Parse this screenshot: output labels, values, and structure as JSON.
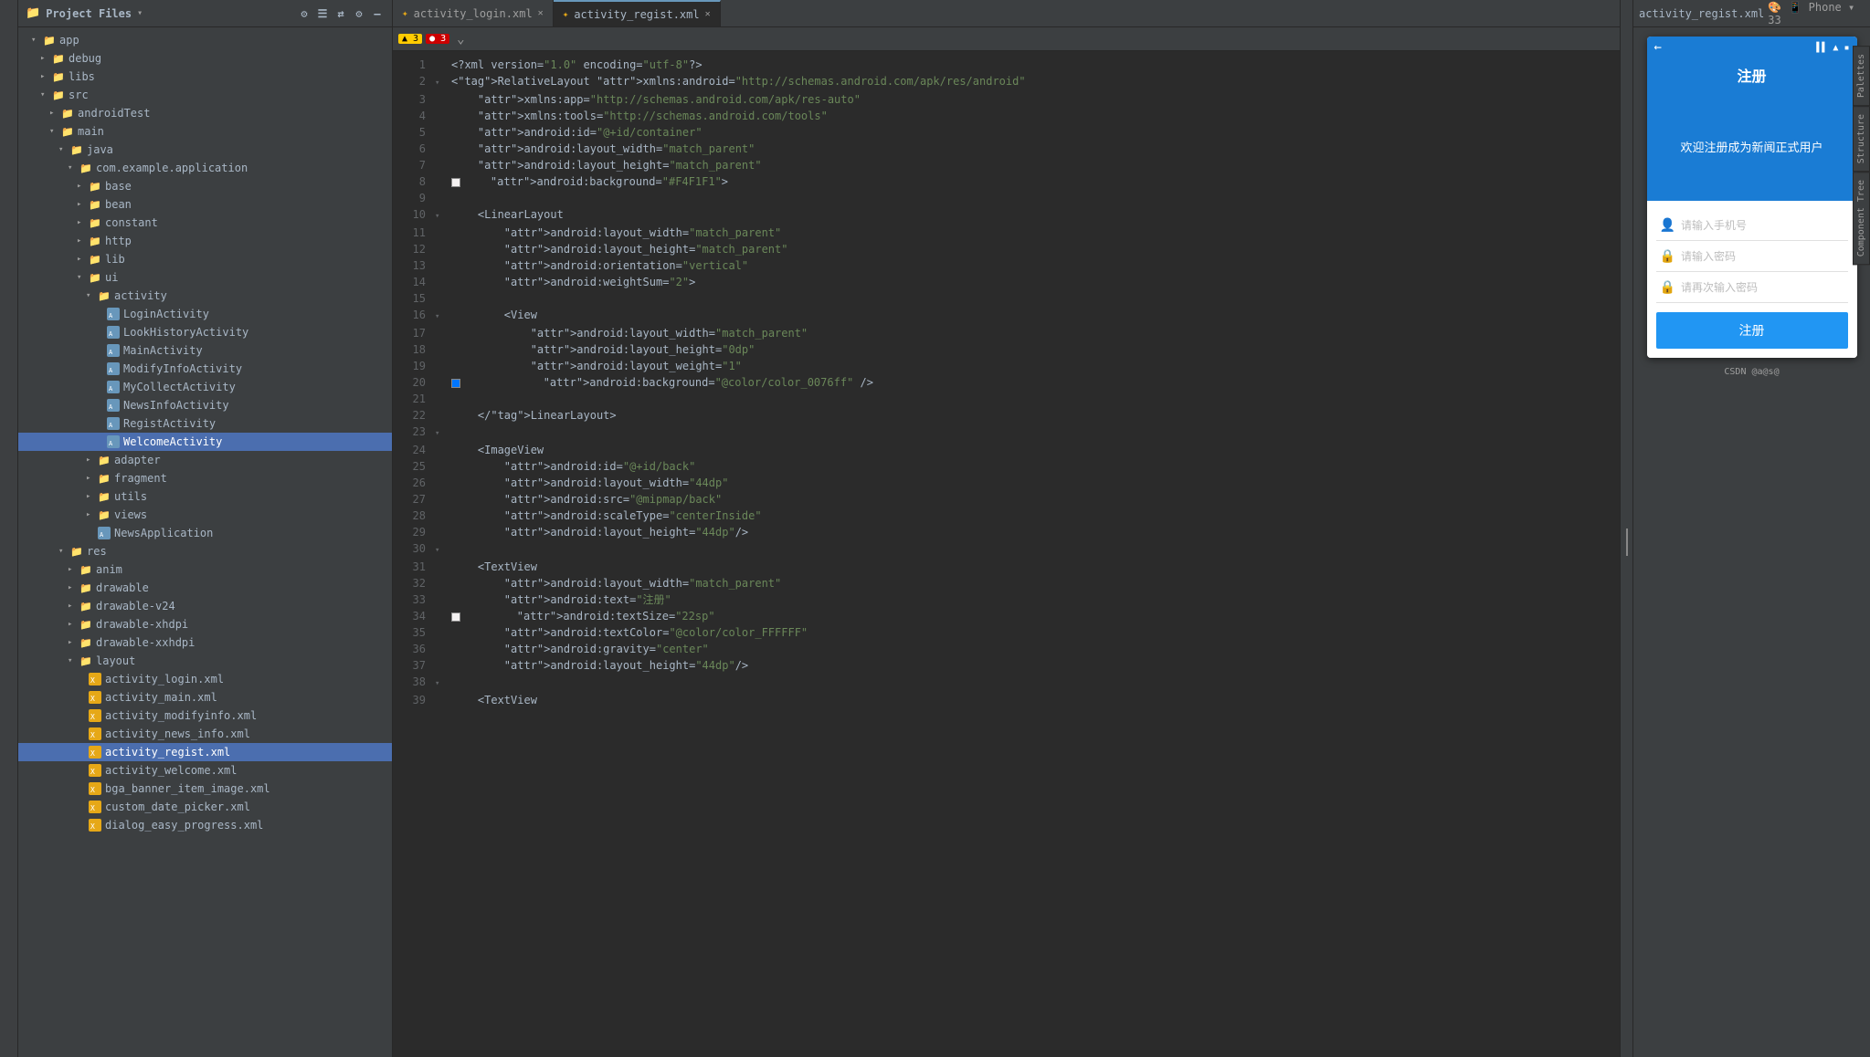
{
  "sidebar": {
    "title": "Project Files",
    "tree": [
      {
        "id": 1,
        "label": "app",
        "type": "folder",
        "indent": 1,
        "expanded": true,
        "arrow": "▾"
      },
      {
        "id": 2,
        "label": "debug",
        "type": "folder",
        "indent": 2,
        "expanded": false,
        "arrow": "▸"
      },
      {
        "id": 3,
        "label": "libs",
        "type": "folder",
        "indent": 2,
        "expanded": false,
        "arrow": "▸"
      },
      {
        "id": 4,
        "label": "src",
        "type": "folder",
        "indent": 2,
        "expanded": true,
        "arrow": "▾"
      },
      {
        "id": 5,
        "label": "androidTest",
        "type": "folder",
        "indent": 3,
        "expanded": false,
        "arrow": "▸"
      },
      {
        "id": 6,
        "label": "main",
        "type": "folder",
        "indent": 3,
        "expanded": true,
        "arrow": "▾"
      },
      {
        "id": 7,
        "label": "java",
        "type": "folder",
        "indent": 4,
        "expanded": true,
        "arrow": "▾"
      },
      {
        "id": 8,
        "label": "com.example.application",
        "type": "folder",
        "indent": 5,
        "expanded": true,
        "arrow": "▾"
      },
      {
        "id": 9,
        "label": "base",
        "type": "folder",
        "indent": 6,
        "expanded": false,
        "arrow": "▸"
      },
      {
        "id": 10,
        "label": "bean",
        "type": "folder",
        "indent": 6,
        "expanded": false,
        "arrow": "▸"
      },
      {
        "id": 11,
        "label": "constant",
        "type": "folder",
        "indent": 6,
        "expanded": false,
        "arrow": "▸"
      },
      {
        "id": 12,
        "label": "http",
        "type": "folder",
        "indent": 6,
        "expanded": false,
        "arrow": "▸"
      },
      {
        "id": 13,
        "label": "lib",
        "type": "folder",
        "indent": 6,
        "expanded": false,
        "arrow": "▸"
      },
      {
        "id": 14,
        "label": "ui",
        "type": "folder",
        "indent": 6,
        "expanded": true,
        "arrow": "▾"
      },
      {
        "id": 15,
        "label": "activity",
        "type": "folder",
        "indent": 7,
        "expanded": true,
        "arrow": "▾"
      },
      {
        "id": 16,
        "label": "LoginActivity",
        "type": "java-act",
        "indent": 8
      },
      {
        "id": 17,
        "label": "LookHistoryActivity",
        "type": "java-act",
        "indent": 8
      },
      {
        "id": 18,
        "label": "MainActivity",
        "type": "java-act",
        "indent": 8
      },
      {
        "id": 19,
        "label": "ModifyInfoActivity",
        "type": "java-act",
        "indent": 8
      },
      {
        "id": 20,
        "label": "MyCollectActivity",
        "type": "java-act",
        "indent": 8
      },
      {
        "id": 21,
        "label": "NewsInfoActivity",
        "type": "java-act",
        "indent": 8
      },
      {
        "id": 22,
        "label": "RegistActivity",
        "type": "java-act",
        "indent": 8
      },
      {
        "id": 23,
        "label": "WelcomeActivity",
        "type": "java-act",
        "indent": 8,
        "selected": true
      },
      {
        "id": 24,
        "label": "adapter",
        "type": "folder",
        "indent": 7,
        "expanded": false,
        "arrow": "▸"
      },
      {
        "id": 25,
        "label": "fragment",
        "type": "folder",
        "indent": 7,
        "expanded": false,
        "arrow": "▸"
      },
      {
        "id": 26,
        "label": "utils",
        "type": "folder",
        "indent": 7,
        "expanded": false,
        "arrow": "▸"
      },
      {
        "id": 27,
        "label": "views",
        "type": "folder",
        "indent": 7,
        "expanded": false,
        "arrow": "▸"
      },
      {
        "id": 28,
        "label": "NewsApplication",
        "type": "java-act",
        "indent": 7
      },
      {
        "id": 29,
        "label": "res",
        "type": "folder",
        "indent": 4,
        "expanded": true,
        "arrow": "▾"
      },
      {
        "id": 30,
        "label": "anim",
        "type": "folder",
        "indent": 5,
        "expanded": false,
        "arrow": "▸"
      },
      {
        "id": 31,
        "label": "drawable",
        "type": "folder",
        "indent": 5,
        "expanded": false,
        "arrow": "▸"
      },
      {
        "id": 32,
        "label": "drawable-v24",
        "type": "folder",
        "indent": 5,
        "expanded": false,
        "arrow": "▸"
      },
      {
        "id": 33,
        "label": "drawable-xhdpi",
        "type": "folder",
        "indent": 5,
        "expanded": false,
        "arrow": "▸"
      },
      {
        "id": 34,
        "label": "drawable-xxhdpi",
        "type": "folder",
        "indent": 5,
        "expanded": false,
        "arrow": "▸"
      },
      {
        "id": 35,
        "label": "layout",
        "type": "folder",
        "indent": 5,
        "expanded": true,
        "arrow": "▾"
      },
      {
        "id": 36,
        "label": "activity_login.xml",
        "type": "xml",
        "indent": 6
      },
      {
        "id": 37,
        "label": "activity_main.xml",
        "type": "xml",
        "indent": 6
      },
      {
        "id": 38,
        "label": "activity_modifyinfo.xml",
        "type": "xml",
        "indent": 6
      },
      {
        "id": 39,
        "label": "activity_news_info.xml",
        "type": "xml",
        "indent": 6
      },
      {
        "id": 40,
        "label": "activity_regist.xml",
        "type": "xml",
        "indent": 6,
        "selected": true
      },
      {
        "id": 41,
        "label": "activity_welcome.xml",
        "type": "xml",
        "indent": 6
      },
      {
        "id": 42,
        "label": "bga_banner_item_image.xml",
        "type": "xml",
        "indent": 6
      },
      {
        "id": 43,
        "label": "custom_date_picker.xml",
        "type": "xml",
        "indent": 6
      },
      {
        "id": 44,
        "label": "dialog_easy_progress.xml",
        "type": "xml",
        "indent": 6
      }
    ]
  },
  "tabs": [
    {
      "label": "activity_login.xml",
      "active": false
    },
    {
      "label": "activity_regist.xml",
      "active": true
    }
  ],
  "editor": {
    "filename": "activity_regist.xml",
    "warnings": "3",
    "errors": "3",
    "lines": [
      {
        "num": 1,
        "code": "<?xml version=\"1.0\" encoding=\"utf-8\"?>"
      },
      {
        "num": 2,
        "code": "<RelativeLayout xmlns:android=\"http://schemas.android.com/apk/res/android\""
      },
      {
        "num": 3,
        "code": "    xmlns:app=\"http://schemas.android.com/apk/res-auto\""
      },
      {
        "num": 4,
        "code": "    xmlns:tools=\"http://schemas.android.com/tools\""
      },
      {
        "num": 5,
        "code": "    android:id=\"@+id/container\""
      },
      {
        "num": 6,
        "code": "    android:layout_width=\"match_parent\""
      },
      {
        "num": 7,
        "code": "    android:layout_height=\"match_parent\""
      },
      {
        "num": 8,
        "code": "    android:background=\"#F4F1F1\">"
      },
      {
        "num": 9,
        "code": ""
      },
      {
        "num": 10,
        "code": "    <LinearLayout"
      },
      {
        "num": 11,
        "code": "        android:layout_width=\"match_parent\""
      },
      {
        "num": 12,
        "code": "        android:layout_height=\"match_parent\""
      },
      {
        "num": 13,
        "code": "        android:orientation=\"vertical\""
      },
      {
        "num": 14,
        "code": "        android:weightSum=\"2\">"
      },
      {
        "num": 15,
        "code": ""
      },
      {
        "num": 16,
        "code": "        <View"
      },
      {
        "num": 17,
        "code": "            android:layout_width=\"match_parent\""
      },
      {
        "num": 18,
        "code": "            android:layout_height=\"0dp\""
      },
      {
        "num": 19,
        "code": "            android:layout_weight=\"1\""
      },
      {
        "num": 20,
        "code": "            android:background=\"@color/color_0076ff\" />"
      },
      {
        "num": 21,
        "code": ""
      },
      {
        "num": 22,
        "code": "    </LinearLayout>"
      },
      {
        "num": 23,
        "code": ""
      },
      {
        "num": 24,
        "code": "    <ImageView"
      },
      {
        "num": 25,
        "code": "        android:id=\"@+id/back\""
      },
      {
        "num": 26,
        "code": "        android:layout_width=\"44dp\""
      },
      {
        "num": 27,
        "code": "        android:src=\"@mipmap/back\""
      },
      {
        "num": 28,
        "code": "        android:scaleType=\"centerInside\""
      },
      {
        "num": 29,
        "code": "        android:layout_height=\"44dp\"/>"
      },
      {
        "num": 30,
        "code": ""
      },
      {
        "num": 31,
        "code": "    <TextView"
      },
      {
        "num": 32,
        "code": "        android:layout_width=\"match_parent\""
      },
      {
        "num": 33,
        "code": "        android:text=\"注册\""
      },
      {
        "num": 34,
        "code": "        android:textSize=\"22sp\""
      },
      {
        "num": 35,
        "code": "        android:textColor=\"@color/color_FFFFFF\""
      },
      {
        "num": 36,
        "code": "        android:gravity=\"center\""
      },
      {
        "num": 37,
        "code": "        android:layout_height=\"44dp\"/>"
      },
      {
        "num": 38,
        "code": ""
      },
      {
        "num": 39,
        "code": "    <TextView"
      }
    ]
  },
  "preview": {
    "title": "注册",
    "welcome_text": "欢迎注册成为新闻正式用户",
    "input1_placeholder": "请输入手机号",
    "input2_placeholder": "请输入密码",
    "input3_placeholder": "请再次输入密码",
    "btn_label": "注册",
    "phone_model": "Phone",
    "zoom": "33"
  },
  "toolbar": {
    "file_label": "activity_regist.xml"
  }
}
